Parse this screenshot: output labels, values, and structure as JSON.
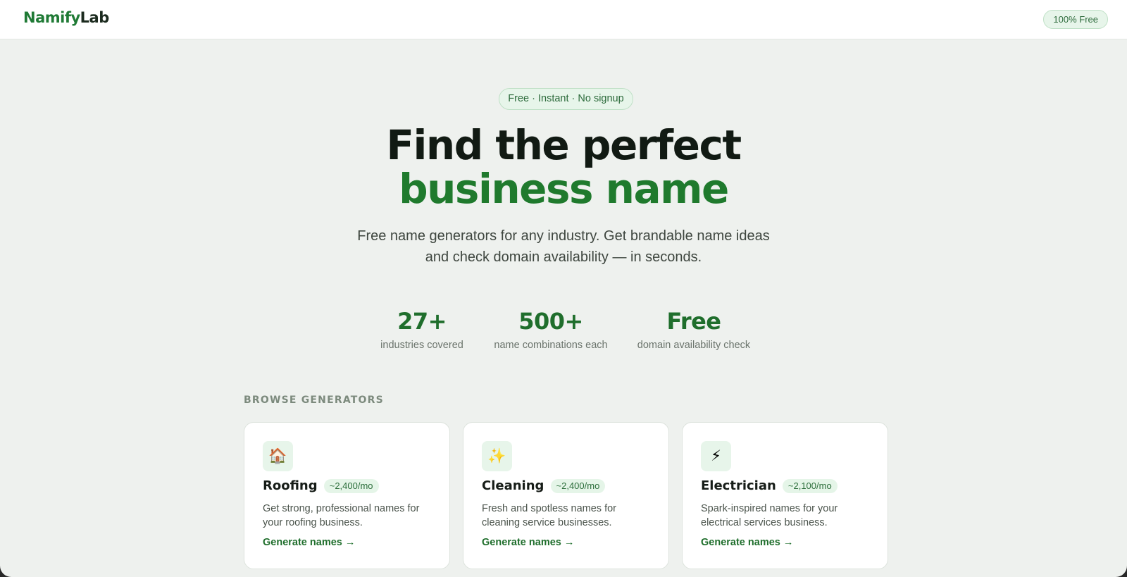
{
  "brand": {
    "part1": "Namify",
    "part2": "Lab"
  },
  "header": {
    "pill": "100% Free"
  },
  "hero": {
    "pill": "Free · Instant · No signup",
    "title_line1": "Find the perfect",
    "title_line2": "business name",
    "subtitle_line1": "Free name generators for any industry. Get brandable name ideas",
    "subtitle_line2": "and check domain availability — in seconds."
  },
  "stats": [
    {
      "value": "27+",
      "label": "industries covered"
    },
    {
      "value": "500+",
      "label": "name combinations each"
    },
    {
      "value": "Free",
      "label": "domain availability check"
    }
  ],
  "browse": {
    "heading": "BROWSE GENERATORS"
  },
  "cards": [
    {
      "icon": "house-icon",
      "emoji": "🏠",
      "title": "Roofing",
      "badge": "~2,400/mo",
      "desc": "Get strong, professional names for your roofing business.",
      "link": "Generate names →"
    },
    {
      "icon": "sparkles-icon",
      "emoji": "✨",
      "title": "Cleaning",
      "badge": "~2,400/mo",
      "desc": "Fresh and spotless names for cleaning service businesses.",
      "link": "Generate names →"
    },
    {
      "icon": "lightning-icon",
      "emoji": "⚡",
      "title": "Electrician",
      "badge": "~2,100/mo",
      "desc": "Spark-inspired names for your electrical services business.",
      "link": "Generate names →"
    }
  ],
  "colors": {
    "accent": "#1f7a2d",
    "pill_bg": "#e7f5ea",
    "page_bg": "#eef1ee"
  }
}
